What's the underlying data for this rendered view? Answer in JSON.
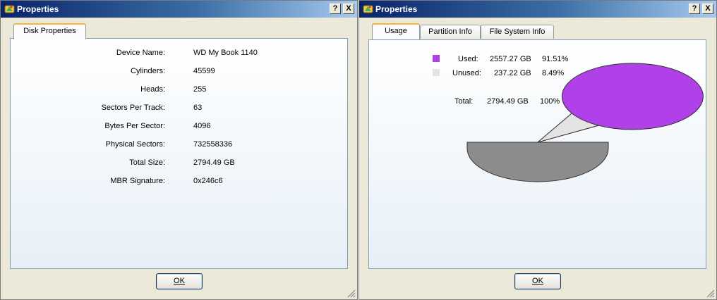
{
  "left_window": {
    "title": "Properties",
    "help_label": "?",
    "close_label": "X",
    "tab_label": "Disk Properties",
    "rows": [
      {
        "label": "Device Name:",
        "value": "WD My Book 1140"
      },
      {
        "label": "Cylinders:",
        "value": "45599"
      },
      {
        "label": "Heads:",
        "value": "255"
      },
      {
        "label": "Sectors Per Track:",
        "value": "63"
      },
      {
        "label": "Bytes Per Sector:",
        "value": "4096"
      },
      {
        "label": "Physical Sectors:",
        "value": "732558336"
      },
      {
        "label": "Total Size:",
        "value": "2794.49 GB"
      },
      {
        "label": "MBR Signature:",
        "value": "0x246c6"
      }
    ],
    "ok_label": "OK"
  },
  "right_window": {
    "title": "Properties",
    "help_label": "?",
    "close_label": "X",
    "tabs": [
      {
        "label": "Usage",
        "active": true
      },
      {
        "label": "Partition Info",
        "active": false
      },
      {
        "label": "File System Info",
        "active": false
      }
    ],
    "usage": {
      "used": {
        "label": "Used:",
        "size": "2557.27 GB",
        "percent": "91.51%",
        "color": "#b040e8"
      },
      "unused": {
        "label": "Unused:",
        "size": "237.22 GB",
        "percent": "8.49%",
        "color": "#e4e4e4"
      },
      "total": {
        "label": "Total:",
        "size": "2794.49 GB",
        "percent": "100%"
      }
    },
    "chart_data": {
      "type": "pie",
      "categories": [
        "Used",
        "Unused"
      ],
      "values": [
        91.51,
        8.49
      ],
      "colors": [
        "#b040e8",
        "#e4e4e4"
      ]
    },
    "ok_label": "OK"
  }
}
